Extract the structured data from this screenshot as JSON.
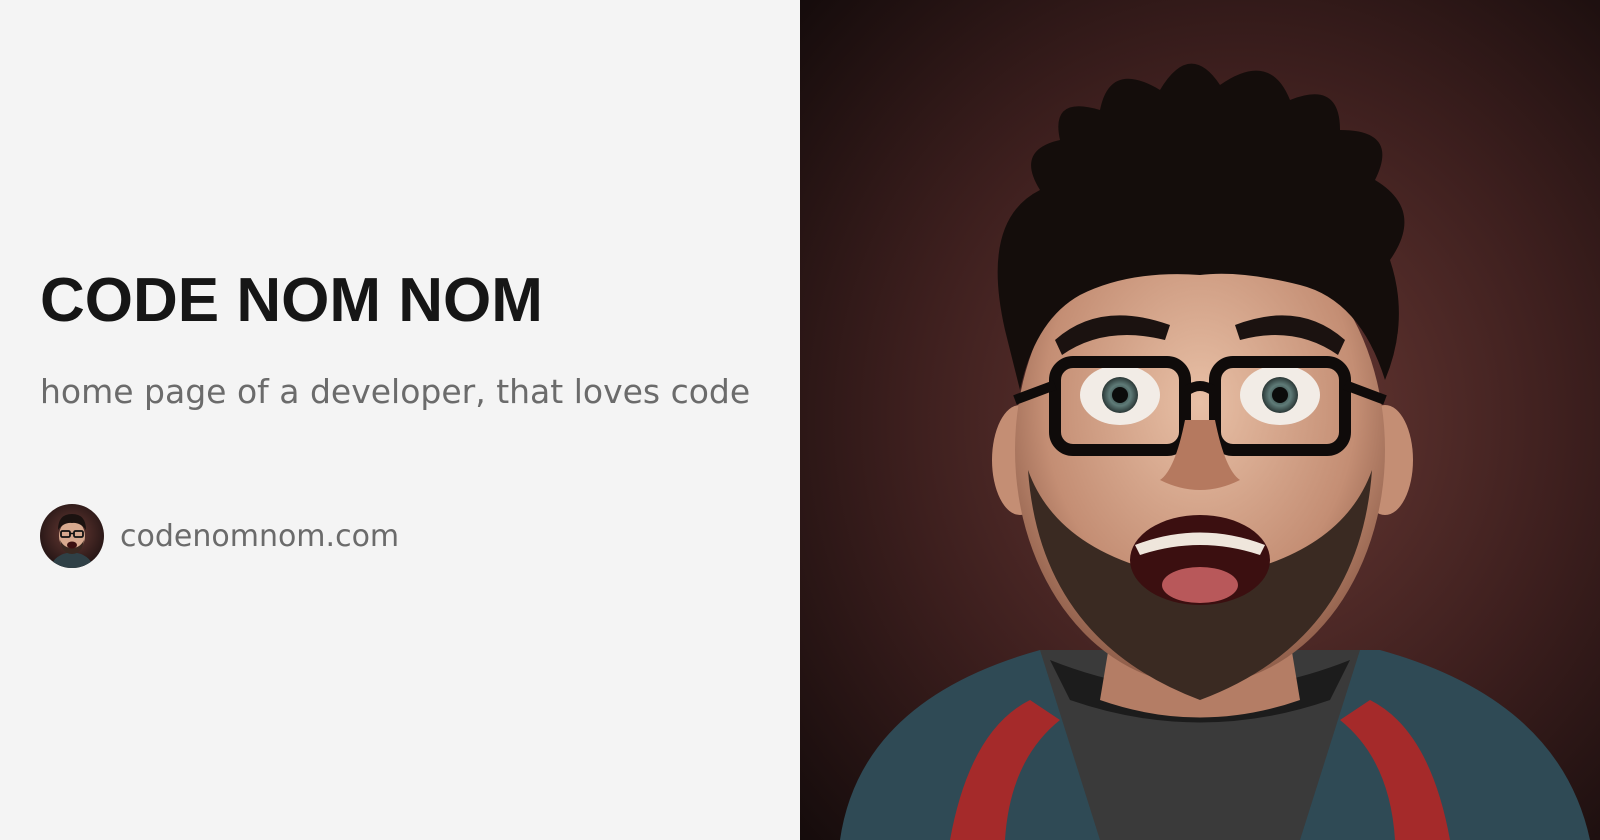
{
  "header": {
    "title": "CODE NOM NOM",
    "subtitle": "home page of a developer, that loves code"
  },
  "site": {
    "url": "codenomnom.com",
    "avatar_icon": "developer-avatar"
  },
  "hero": {
    "image": "excited-developer-portrait"
  },
  "colors": {
    "background": "#f4f4f4",
    "title": "#161616",
    "muted_text": "#6b6b6b",
    "photo_background": "#3a1f1f"
  }
}
